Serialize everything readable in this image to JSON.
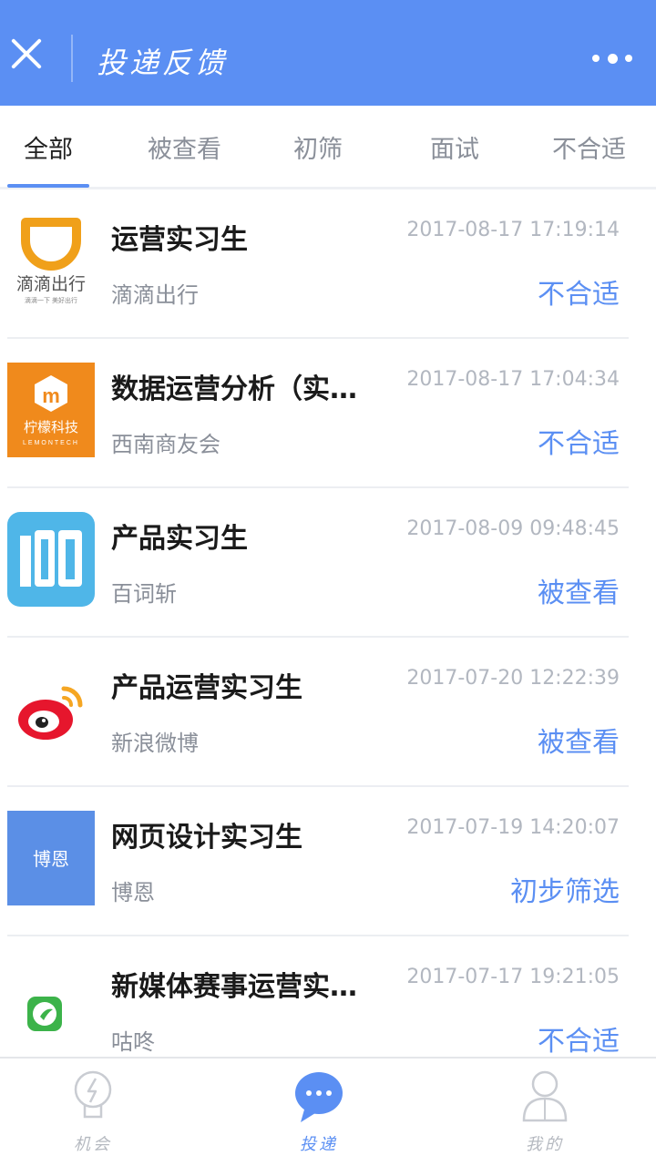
{
  "header": {
    "title": "投递反馈",
    "close_icon": "close-icon",
    "more_icon": "more-dots-icon",
    "background": "#5b8ff3"
  },
  "tabs": [
    {
      "label": "全部",
      "active": true
    },
    {
      "label": "被查看",
      "active": false
    },
    {
      "label": "初筛",
      "active": false
    },
    {
      "label": "面试",
      "active": false
    },
    {
      "label": "不合适",
      "active": false
    }
  ],
  "applications": [
    {
      "title": "运营实习生",
      "company": "滴滴出行",
      "time": "2017-08-17 17:19:14",
      "status": "不合适",
      "logo_text": "滴滴出行",
      "logo_subtext": "滴滴一下 美好出行",
      "logo_icon": "didi-logo"
    },
    {
      "title": "数据运营分析（实…",
      "company": "西南商友会",
      "time": "2017-08-17 17:04:34",
      "status": "不合适",
      "logo_text": "柠檬科技",
      "logo_subtext": "LEMONTECH",
      "logo_icon": "lemontech-logo"
    },
    {
      "title": "产品实习生",
      "company": "百词斩",
      "time": "2017-08-09 09:48:45",
      "status": "被查看",
      "logo_text": "100",
      "logo_icon": "baicizhan-logo"
    },
    {
      "title": "产品运营实习生",
      "company": "新浪微博",
      "time": "2017-07-20 12:22:39",
      "status": "被查看",
      "logo_icon": "weibo-logo"
    },
    {
      "title": "网页设计实习生",
      "company": "博恩",
      "time": "2017-07-19 14:20:07",
      "status": "初步筛选",
      "logo_text": "博恩",
      "logo_icon": "boen-logo"
    },
    {
      "title": "新媒体赛事运营实…",
      "company": "咕咚",
      "time": "2017-07-17 19:21:05",
      "status": "不合适",
      "logo_icon": "codoon-logo"
    }
  ],
  "bottom_nav": [
    {
      "label": "机会",
      "icon": "lightbulb-icon",
      "active": false
    },
    {
      "label": "投递",
      "icon": "chat-bubble-icon",
      "active": true
    },
    {
      "label": "我的",
      "icon": "person-icon",
      "active": false
    }
  ]
}
